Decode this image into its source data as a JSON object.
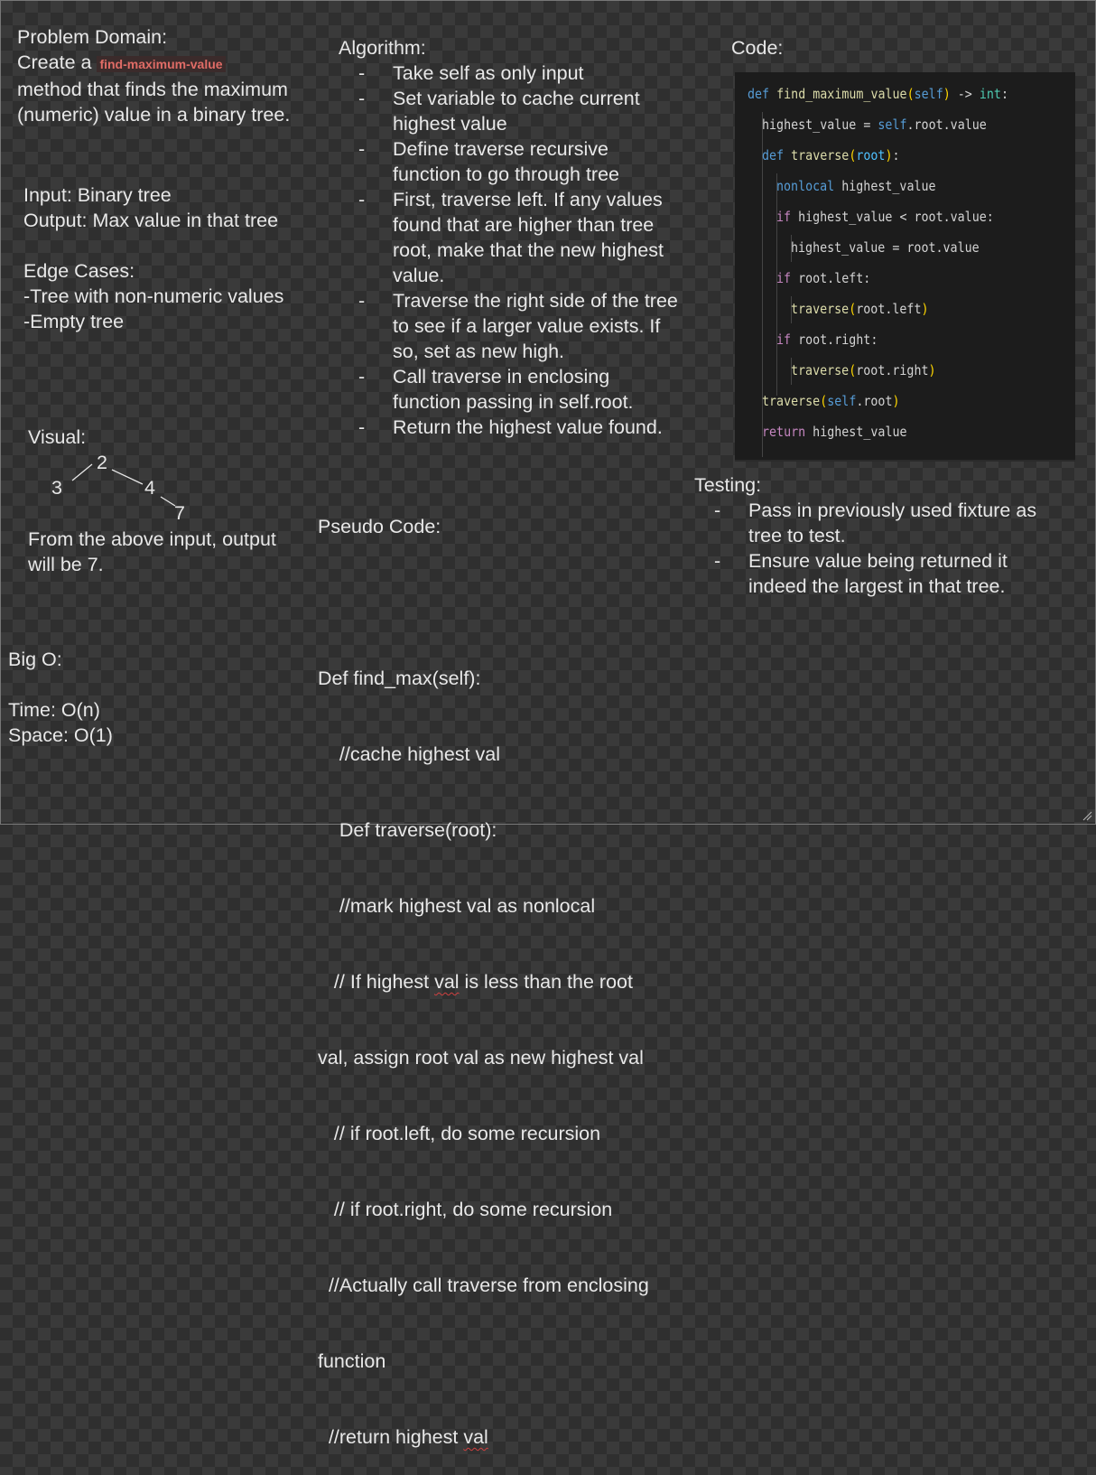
{
  "problem": {
    "heading": "Problem Domain:",
    "line1_prefix": "Create a ",
    "method_name": "find-maximum-value",
    "line2": "method that finds the maximum",
    "line3": "(numeric) value in a binary tree."
  },
  "io": {
    "input": "Input: Binary tree",
    "output": "Output: Max value in that tree"
  },
  "edge_cases": {
    "heading": "Edge Cases:",
    "items": [
      "-Tree with non-numeric values",
      "-Empty tree"
    ]
  },
  "visual": {
    "heading": "Visual:",
    "nodes": {
      "root": "2",
      "left": "3",
      "right": "4",
      "right_right": "7"
    },
    "caption_line1": "From the above input, output",
    "caption_line2": "will be 7."
  },
  "big_o": {
    "heading": "Big O:",
    "time": "Time: O(n)",
    "space": "Space: O(1)"
  },
  "algorithm": {
    "heading": "Algorithm:",
    "dash": "-",
    "items": [
      [
        "Take self as only input"
      ],
      [
        "Set variable to cache current",
        "highest value"
      ],
      [
        "Define traverse recursive",
        "function to go through tree"
      ],
      [
        "First, traverse left. If any values",
        "found that are higher than tree",
        "root, make that the new highest",
        "value."
      ],
      [
        "Traverse the right side of the tree",
        "to see if a larger value exists. If",
        "so, set as new high."
      ],
      [
        "Call traverse in enclosing",
        "function passing in self.root."
      ],
      [
        "Return the highest value found."
      ]
    ]
  },
  "pseudo": {
    "heading": "Pseudo Code:",
    "lines": [
      "Def find_max(self):",
      "    //cache highest val",
      "    Def traverse(root):",
      "    //mark highest val as nonlocal",
      "   // If highest ",
      "val, assign root val as new highest val",
      "   // if root.left, do some recursion",
      "   // if root.right, do some recursion",
      "  //Actually call traverse from enclosing",
      "function",
      "  //return highest "
    ],
    "line5_squiggle": "val",
    "line5_rest": " is less than the root",
    "line11_squiggle": "val"
  },
  "code": {
    "heading": "Code:",
    "lines": {
      "l1_def": "def",
      "l1_name": "find_maximum_value",
      "l1_open": "(",
      "l1_self": "self",
      "l1_close": ")",
      "l1_arrow": " -> ",
      "l1_type": "int",
      "l1_colon": ":",
      "l2_a": "highest_value = ",
      "l2_self": "self",
      "l2_b": ".root.value",
      "l3_def": "def",
      "l3_name": "traverse",
      "l3_open": "(",
      "l3_param": "root",
      "l3_close": ")",
      "l3_colon": ":",
      "l4_kw": "nonlocal",
      "l4_b": " highest_value",
      "l5_kw": "if",
      "l5_b": " highest_value < root.value:",
      "l6": "highest_value = root.value",
      "l7_kw": "if",
      "l7_b": " root.left:",
      "l8_fn": "traverse",
      "l8_open": "(",
      "l8_b": "root.left",
      "l8_close": ")",
      "l9_kw": "if",
      "l9_b": " root.right:",
      "l10_fn": "traverse",
      "l10_open": "(",
      "l10_b": "root.right",
      "l10_close": ")",
      "l11_fn": "traverse",
      "l11_open": "(",
      "l11_self": "self",
      "l11_b": ".root",
      "l11_close": ")",
      "l12_kw": "return",
      "l12_b": " highest_value"
    }
  },
  "testing": {
    "heading": "Testing:",
    "dash": "-",
    "items": [
      [
        "Pass in previously used fixture as",
        "tree to test."
      ],
      [
        "Ensure value being returned it",
        "indeed the largest in that tree."
      ]
    ]
  }
}
